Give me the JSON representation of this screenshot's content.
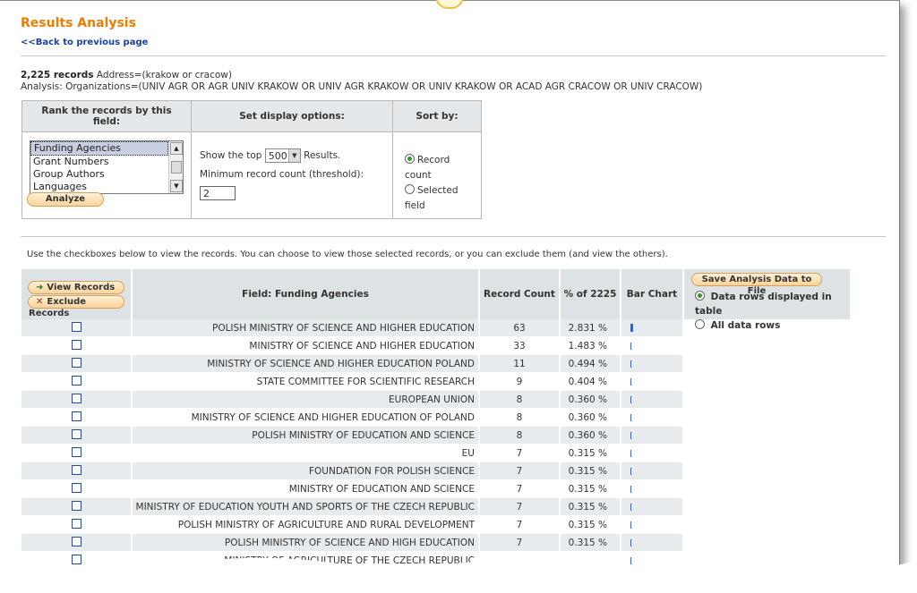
{
  "page": {
    "title": "Results Analysis",
    "back_link": "<<Back to previous page",
    "record_count": "2,225 records",
    "address_query": "Address=(krakow or cracow)",
    "analysis_line": "Analysis: Organizations=(UNIV AGR OR AGR UNIV KRAKOW OR UNIV AGR KRAKOW OR UNIV KRAKOW OR ACAD AGR CRACOW OR UNIV CRACOW)"
  },
  "options": {
    "rank_header": "Rank the records by this field:",
    "display_header": "Set display options:",
    "sort_header": "Sort by:",
    "fields": [
      "Funding Agencies",
      "Grant Numbers",
      "Group Authors",
      "Languages"
    ],
    "show_top_prefix": "Show the top",
    "show_top_value": "500",
    "show_top_suffix": "Results.",
    "threshold_label": "Minimum record count (threshold):",
    "threshold_value": "2",
    "sort_record_count": "Record count",
    "sort_selected_field": "Selected field",
    "analyze_button": "Analyze"
  },
  "instructions": "Use the checkboxes below to view the records. You can choose to view those selected records, or you can exclude them (and view the others).",
  "table": {
    "view_records": "View Records",
    "exclude_records": "Exclude Records",
    "col_field": "Field: Funding Agencies",
    "col_count": "Record Count",
    "col_pct": "% of 2225",
    "col_bar": "Bar Chart",
    "save_button": "Save Analysis Data to File",
    "save_displayed": "Data rows displayed in table",
    "save_all": "All data rows",
    "rows": [
      {
        "name": "POLISH MINISTRY OF SCIENCE AND HIGHER EDUCATION",
        "count": "63",
        "pct": "2.831 %",
        "bar": 2.831
      },
      {
        "name": "MINISTRY OF SCIENCE AND HIGHER EDUCATION",
        "count": "33",
        "pct": "1.483 %",
        "bar": 1.483
      },
      {
        "name": "MINISTRY OF SCIENCE AND HIGHER EDUCATION POLAND",
        "count": "11",
        "pct": "0.494 %",
        "bar": 0.494
      },
      {
        "name": "STATE COMMITTEE FOR SCIENTIFIC RESEARCH",
        "count": "9",
        "pct": "0.404 %",
        "bar": 0.404
      },
      {
        "name": "EUROPEAN UNION",
        "count": "8",
        "pct": "0.360 %",
        "bar": 0.36
      },
      {
        "name": "MINISTRY OF SCIENCE AND HIGHER EDUCATION OF POLAND",
        "count": "8",
        "pct": "0.360 %",
        "bar": 0.36
      },
      {
        "name": "POLISH MINISTRY OF EDUCATION AND SCIENCE",
        "count": "8",
        "pct": "0.360 %",
        "bar": 0.36
      },
      {
        "name": "EU",
        "count": "7",
        "pct": "0.315 %",
        "bar": 0.315
      },
      {
        "name": "FOUNDATION FOR POLISH SCIENCE",
        "count": "7",
        "pct": "0.315 %",
        "bar": 0.315
      },
      {
        "name": "MINISTRY OF EDUCATION AND SCIENCE",
        "count": "7",
        "pct": "0.315 %",
        "bar": 0.315
      },
      {
        "name": "MINISTRY OF EDUCATION YOUTH AND SPORTS OF THE CZECH REPUBLIC",
        "count": "7",
        "pct": "0.315 %",
        "bar": 0.315
      },
      {
        "name": "POLISH MINISTRY OF AGRICULTURE AND RURAL DEVELOPMENT",
        "count": "7",
        "pct": "0.315 %",
        "bar": 0.315
      },
      {
        "name": "POLISH MINISTRY OF SCIENCE AND HIGH EDUCATION",
        "count": "7",
        "pct": "0.315 %",
        "bar": 0.315
      },
      {
        "name": "MINISTRY OF AGRICULTURE OF THE CZECH REPUBLIC",
        "count": "",
        "pct": "",
        "bar": 0.315
      }
    ]
  },
  "colors": {
    "title": "#e87e04",
    "link": "#1a3fa0",
    "bar": "#3a60c0"
  }
}
